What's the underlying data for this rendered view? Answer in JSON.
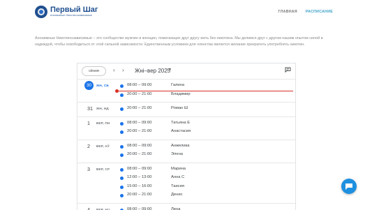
{
  "header": {
    "logo_title": "Первый Шаг",
    "logo_subtitle": "Анонимные Никотинозависимые",
    "nav": [
      {
        "label": "ГЛАВНАЯ"
      },
      {
        "label": "РАСПИСАНИЕ"
      }
    ]
  },
  "intro": "Анонимные Никотинозависимые – это сообщество мужчин и женщин, помогающих друг другу жить без никотина. Мы делимся друг с другом нашим опытом силой и надеждой, чтобы освободиться от этой сильной зависимости. Единственным условием для членства является желание прекратить употреблять никотин.",
  "calendar": {
    "today_label": "сёння",
    "month_label": "Жні–вер 2025",
    "days": [
      {
        "num": "30",
        "name": "ЖН, СБ",
        "today": true,
        "events": [
          {
            "time": "08:00 – 09:00",
            "title": "Галина"
          },
          {
            "time": "20:00 – 21:00",
            "title": "Владимир"
          }
        ]
      },
      {
        "num": "31",
        "name": "ЖН, НД",
        "events": [
          {
            "time": "20:00 – 21:00",
            "title": "Роман Ш"
          }
        ]
      },
      {
        "num": "1",
        "name": "ВЕР, ПН",
        "events": [
          {
            "time": "08:00 – 09:00",
            "title": "Татьяна Е"
          },
          {
            "time": "20:00 – 21:00",
            "title": "Анастасия"
          }
        ]
      },
      {
        "num": "2",
        "name": "ВЕР, АЎ",
        "events": [
          {
            "time": "08:00 – 09:00",
            "title": "Анжелика"
          },
          {
            "time": "20:00 – 21:00",
            "title": "Элена"
          }
        ]
      },
      {
        "num": "3",
        "name": "ВЕР, СР",
        "events": [
          {
            "time": "08:00 – 09:00",
            "title": "Марина"
          },
          {
            "time": "12:00 – 13:00",
            "title": "Анна С"
          },
          {
            "time": "15:00 – 16:00",
            "title": "Таисия"
          },
          {
            "time": "20:00 – 21:00",
            "title": "Денис"
          }
        ]
      },
      {
        "num": "4",
        "name": "ВЕР, ЧЦ",
        "events": [
          {
            "time": "08:00 – 09:00",
            "title": "Лена"
          }
        ]
      }
    ]
  },
  "colors": {
    "accent": "#1a73e8",
    "now_line": "#d93025",
    "brand": "#1f4f8f",
    "nav_active": "#3aa0c8"
  }
}
